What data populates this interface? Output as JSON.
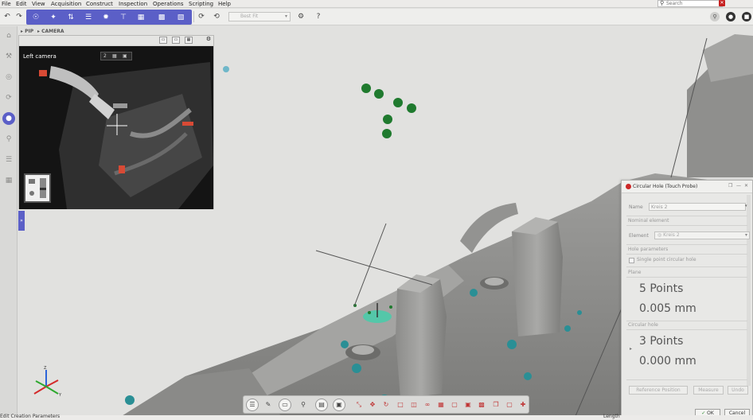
{
  "menu": {
    "items": [
      "File",
      "Edit",
      "View",
      "Acquisition",
      "Construct",
      "Inspection",
      "Operations",
      "Scripting",
      "Help"
    ],
    "search_placeholder": "Search"
  },
  "toolbar": {
    "fit_select": "Best Fit"
  },
  "pip": {
    "tab_pip": "PIP",
    "tab_camera": "CAMERA",
    "camera_label": "Left camera",
    "zoom_value": "2"
  },
  "dialog": {
    "title": "Circular Hole (Touch Probe)",
    "name_label": "Name",
    "name_value": "Kreis 2",
    "nominal_section": "Nominal element",
    "element_label": "Element",
    "element_value": "Kreis 2",
    "hole_params_section": "Hole parameters",
    "single_point_label": "Single point circular hole",
    "single_point_checked": false,
    "plane_section": "Plane",
    "plane_points": "5 Points",
    "plane_value": "0.005 mm",
    "circular_hole_section": "Circular hole",
    "hole_points": "3 Points",
    "hole_value": "0.000 mm",
    "btn_reference": "Reference Position",
    "btn_measure": "Measure",
    "btn_undo": "Undo",
    "btn_ok": "OK",
    "btn_cancel": "Cancel"
  },
  "viewport": {
    "axis_labels": {
      "z": "Z",
      "y": "Y"
    }
  },
  "status": {
    "left_text": "Edit Creation Parameters",
    "right_text": "Length"
  },
  "colors": {
    "accent": "#5b5fc7",
    "probe_point": "#1f7a2e",
    "close_red": "#c62020",
    "scan_mesh": "#8e8e8c",
    "deviation_teal": "#2a8f95"
  }
}
